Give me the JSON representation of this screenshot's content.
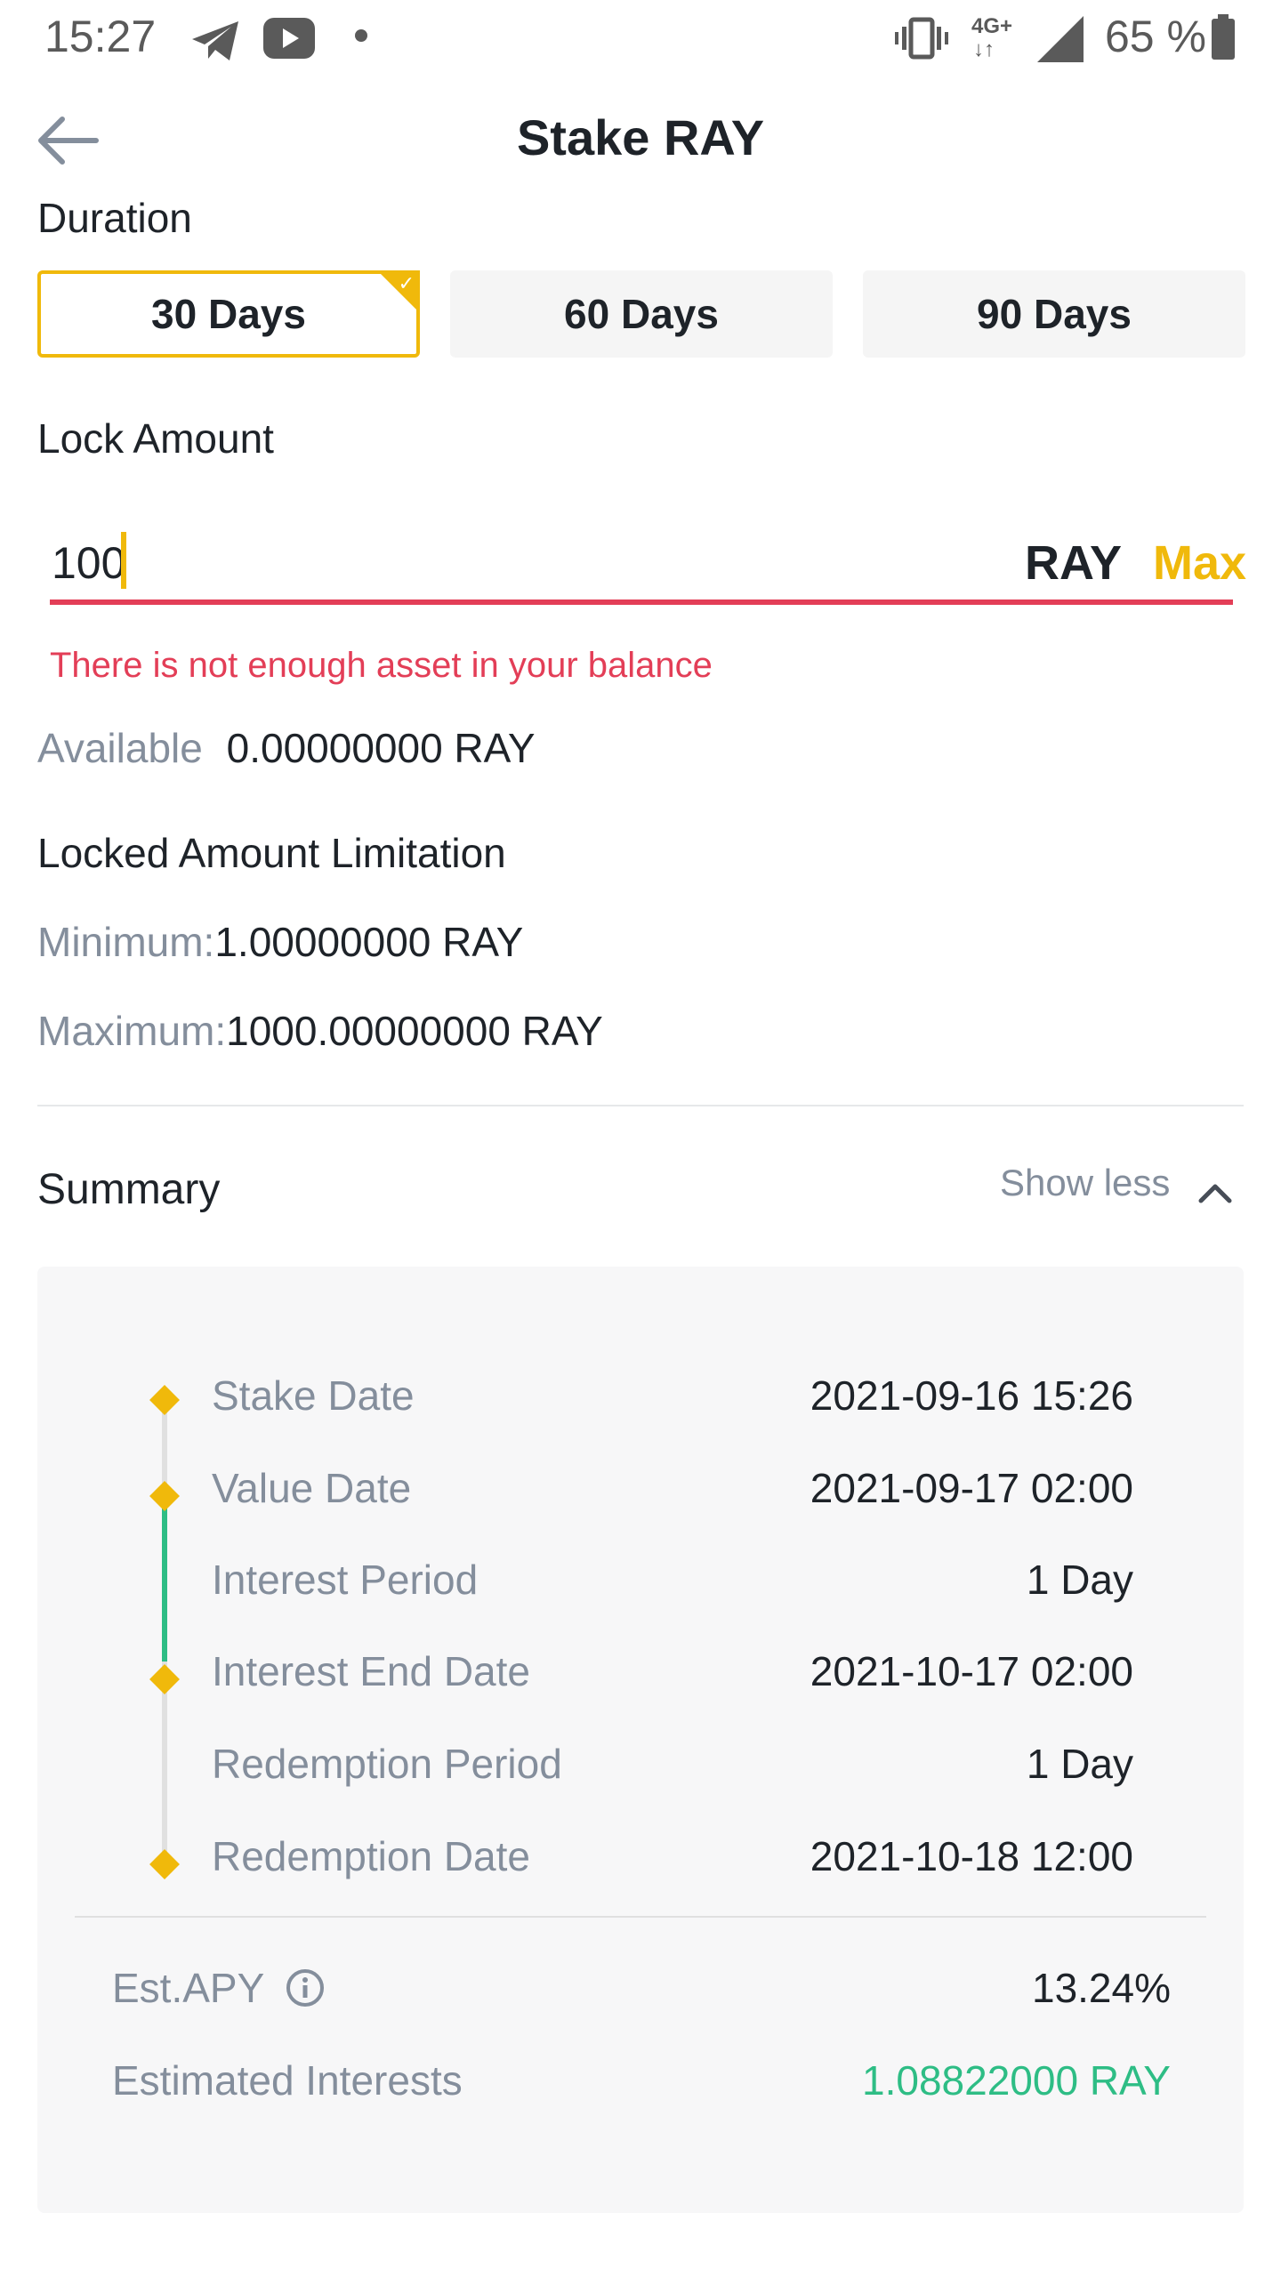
{
  "status_bar": {
    "time": "15:27",
    "icons": [
      "telegram-icon",
      "youtube-icon",
      "notification-dot-icon",
      "vibrate-icon",
      "4g-plus-data-icon",
      "signal-icon",
      "battery-icon"
    ],
    "network": "4G+",
    "battery": "65 %"
  },
  "header": {
    "title": "Stake RAY",
    "back_icon": "arrow-left-icon"
  },
  "duration": {
    "label": "Duration",
    "options": [
      {
        "label": "30 Days",
        "selected": true
      },
      {
        "label": "60 Days",
        "selected": false
      },
      {
        "label": "90 Days",
        "selected": false
      }
    ]
  },
  "lock_amount": {
    "label": "Lock Amount",
    "value": "100",
    "unit": "RAY",
    "max_label": "Max",
    "error": "There is not enough asset in your balance"
  },
  "available": {
    "label": "Available",
    "value": "0.00000000 RAY"
  },
  "limitation": {
    "title": "Locked Amount Limitation",
    "min_label": "Minimum:",
    "min_value": "1.00000000 RAY",
    "max_label": "Maximum:",
    "max_value": "1000.00000000 RAY"
  },
  "summary": {
    "title": "Summary",
    "toggle_label": "Show less",
    "toggle_icon": "chevron-up-icon",
    "timeline": [
      {
        "label": "Stake Date",
        "value": "2021-09-16 15:26"
      },
      {
        "label": "Value Date",
        "value": "2021-09-17 02:00"
      },
      {
        "label": "Interest Period",
        "value": "1 Day"
      },
      {
        "label": "Interest End Date",
        "value": "2021-10-17 02:00"
      },
      {
        "label": "Redemption Period",
        "value": "1 Day"
      },
      {
        "label": "Redemption Date",
        "value": "2021-10-18 12:00"
      }
    ],
    "apy_label": "Est.APY",
    "apy_value": "13.24%",
    "interest_label": "Estimated Interests",
    "interest_value": "1.08822000 RAY"
  },
  "colors": {
    "accent": "#f0b90b",
    "error": "#e33e57",
    "positive": "#2ebd85",
    "muted": "#848e9c"
  }
}
